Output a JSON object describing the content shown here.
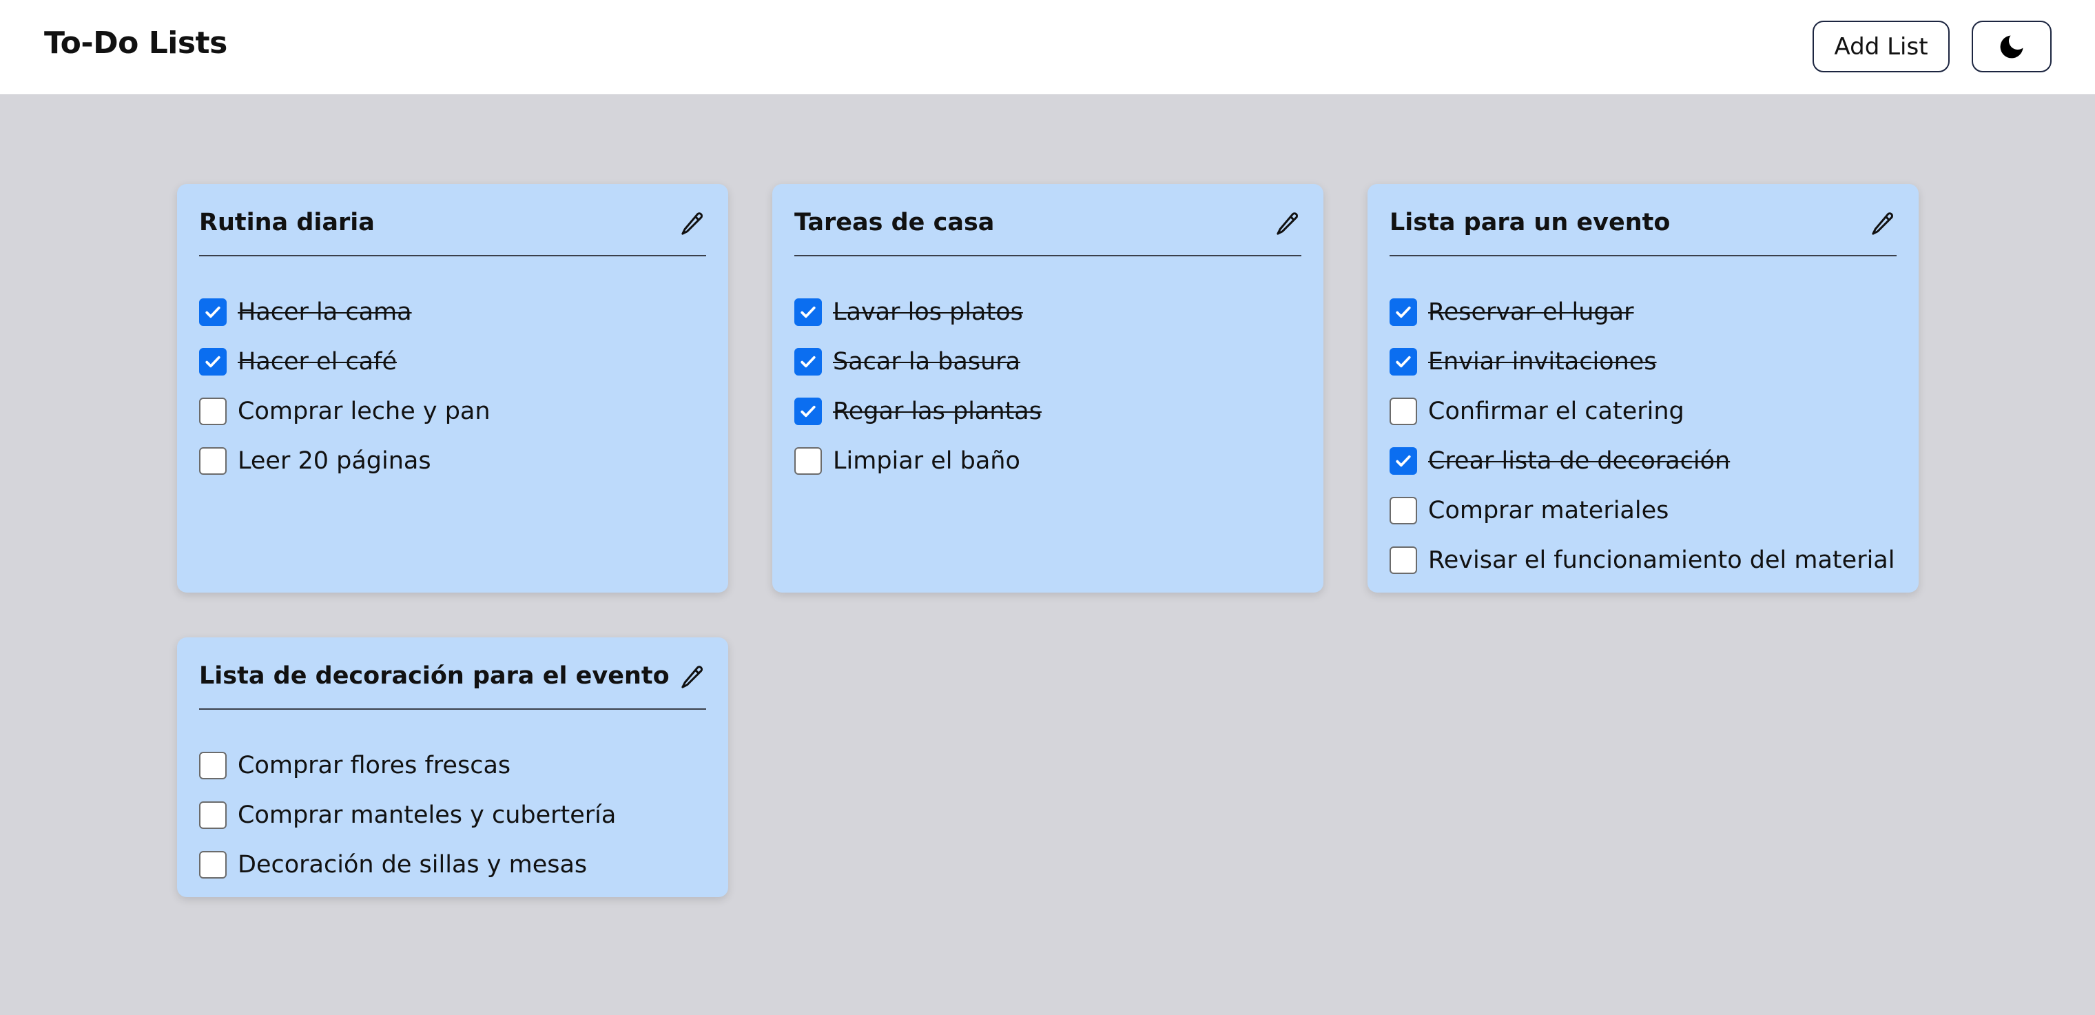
{
  "header": {
    "title": "To-Do Lists",
    "add_list_label": "Add List",
    "theme_toggle_icon": "moon-icon"
  },
  "lists": [
    {
      "title": "Rutina diaria",
      "edit_icon": "pencil-icon",
      "items": [
        {
          "label": "Hacer la cama",
          "done": true
        },
        {
          "label": "Hacer el café",
          "done": true
        },
        {
          "label": "Comprar leche y pan",
          "done": false
        },
        {
          "label": "Leer 20 páginas",
          "done": false
        }
      ]
    },
    {
      "title": "Tareas de casa",
      "edit_icon": "pencil-icon",
      "items": [
        {
          "label": "Lavar los platos",
          "done": true
        },
        {
          "label": "Sacar la basura",
          "done": true
        },
        {
          "label": "Regar las plantas",
          "done": true
        },
        {
          "label": "Limpiar el baño",
          "done": false
        }
      ]
    },
    {
      "title": "Lista para un evento",
      "edit_icon": "pencil-icon",
      "items": [
        {
          "label": "Reservar el lugar",
          "done": true
        },
        {
          "label": "Enviar invitaciones",
          "done": true
        },
        {
          "label": "Confirmar el catering",
          "done": false
        },
        {
          "label": "Crear lista de decoración",
          "done": true
        },
        {
          "label": "Comprar materiales",
          "done": false
        },
        {
          "label": "Revisar el funcionamiento del material",
          "done": false
        }
      ]
    },
    {
      "title": "Lista de decoración para el evento",
      "edit_icon": "pencil-icon",
      "items": [
        {
          "label": "Comprar flores frescas",
          "done": false
        },
        {
          "label": "Comprar manteles y cubertería",
          "done": false
        },
        {
          "label": "Decoración de sillas y mesas",
          "done": false
        }
      ]
    }
  ],
  "colors": {
    "page_background": "#d5d5da",
    "card_background": "#bddafb",
    "checkbox_checked": "#0b6ef0"
  }
}
